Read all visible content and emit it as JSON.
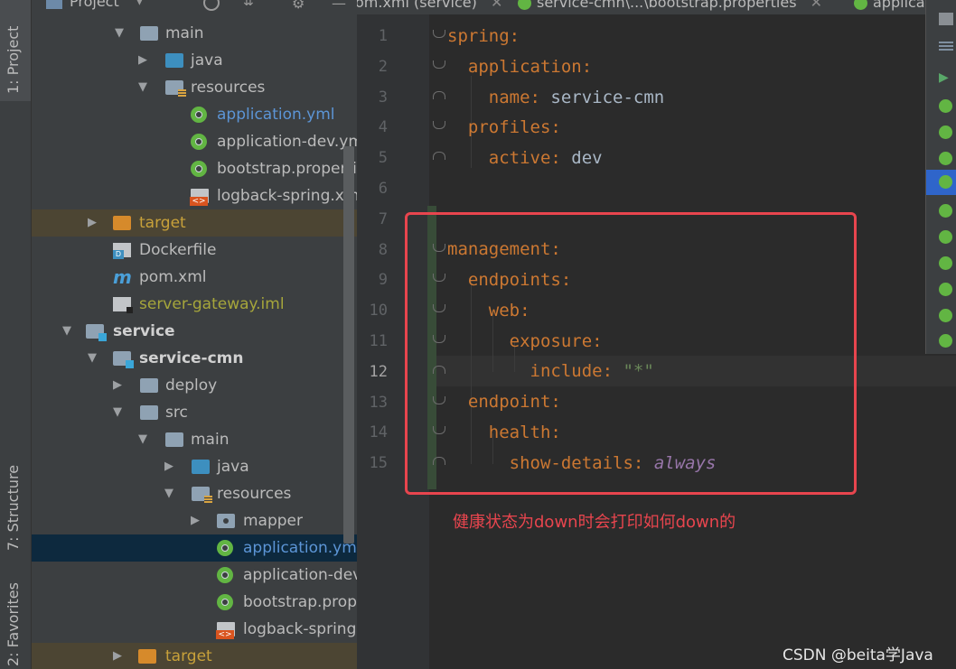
{
  "side_stripe": {
    "project_tab": "1: Project",
    "structure_tab": "7: Structure",
    "favorites_tab": "2: Favorites"
  },
  "project_panel": {
    "header_title": "Project",
    "rows": [
      {
        "label": "main",
        "kind": "folder"
      },
      {
        "label": "java",
        "kind": "folder-blue"
      },
      {
        "label": "resources",
        "kind": "folder-res"
      },
      {
        "label": "application.yml",
        "kind": "spring"
      },
      {
        "label": "application-dev.yml",
        "kind": "spring"
      },
      {
        "label": "bootstrap.properties",
        "kind": "spring"
      },
      {
        "label": "logback-spring.xml",
        "kind": "xml"
      },
      {
        "label": "target",
        "kind": "folder-orange"
      },
      {
        "label": "Dockerfile",
        "kind": "docker"
      },
      {
        "label": "pom.xml",
        "kind": "maven"
      },
      {
        "label": "server-gateway.iml",
        "kind": "iml"
      },
      {
        "label": "service",
        "kind": "module"
      },
      {
        "label": "service-cmn",
        "kind": "module"
      },
      {
        "label": "deploy",
        "kind": "folder"
      },
      {
        "label": "src",
        "kind": "folder"
      },
      {
        "label": "main",
        "kind": "folder"
      },
      {
        "label": "java",
        "kind": "folder-blue"
      },
      {
        "label": "resources",
        "kind": "folder-res"
      },
      {
        "label": "mapper",
        "kind": "package"
      },
      {
        "label": "application.yml",
        "kind": "spring"
      },
      {
        "label": "application-dev.yml",
        "kind": "spring"
      },
      {
        "label": "bootstrap.properties",
        "kind": "spring"
      },
      {
        "label": "logback-spring.xml",
        "kind": "xml"
      },
      {
        "label": "target",
        "kind": "folder-orange"
      }
    ]
  },
  "editor_tabs": [
    {
      "label": "om.xml (service)"
    },
    {
      "label": "service-cmn\\...\\bootstrap.properties"
    },
    {
      "label": "applica"
    }
  ],
  "editor": {
    "line_numbers": [
      "1",
      "2",
      "3",
      "4",
      "5",
      "6",
      "7",
      "8",
      "9",
      "10",
      "11",
      "12",
      "13",
      "14",
      "15"
    ],
    "current_line": "12",
    "code": {
      "l1_key": "spring",
      "l2_key": "application",
      "l3_key": "name",
      "l3_val": "service-cmn",
      "l4_key": "profiles",
      "l5_key": "active",
      "l5_val": "dev",
      "l8_key": "management",
      "l9_key": "endpoints",
      "l10_key": "web",
      "l11_key": "exposure",
      "l12_key": "include",
      "l12_val": "\"*\"",
      "l13_key": "endpoint",
      "l14_key": "health",
      "l15_key": "show-details",
      "l15_val": "always"
    }
  },
  "annotation": {
    "text": "健康状态为down时会打印如何down的",
    "color": "#e8454e"
  },
  "watermark": "CSDN @beita学Java",
  "colors": {
    "yaml_key": "#cc7832",
    "yaml_value": "#a9b7c6",
    "yaml_string": "#6a8759",
    "yaml_constant": "#9876aa",
    "selection": "#0d293e"
  }
}
